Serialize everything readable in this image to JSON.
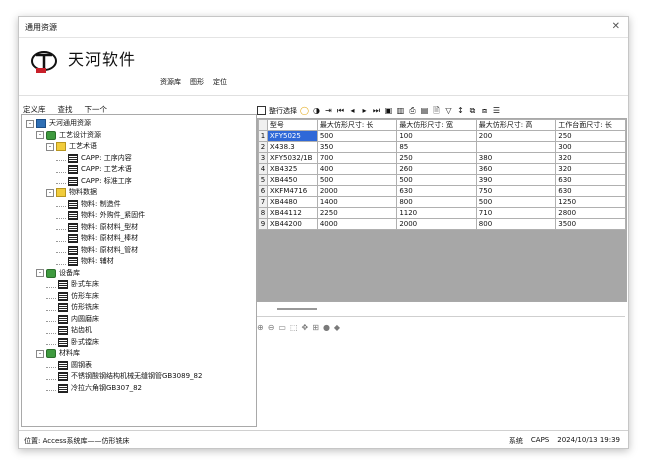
{
  "window": {
    "title": "通用资源"
  },
  "logo": {
    "text": "天河软件",
    "tag": "TIANHE"
  },
  "top_menu": [
    "资源库",
    "图形",
    "定位"
  ],
  "left_menu": [
    "定义库",
    "查找",
    "下一个"
  ],
  "tree": [
    {
      "label": "天河通用资源",
      "depth": 0,
      "icon": "root-icon",
      "expander": "-"
    },
    {
      "label": "工艺设计资源",
      "depth": 1,
      "icon": "gear-folder-icon",
      "expander": "-"
    },
    {
      "label": "工艺术语",
      "depth": 2,
      "icon": "folder-icon",
      "expander": "-"
    },
    {
      "label": "CAPP: 工序内容",
      "depth": 3,
      "icon": "table-icon",
      "expander": ""
    },
    {
      "label": "CAPP: 工艺术语",
      "depth": 3,
      "icon": "table-icon",
      "expander": ""
    },
    {
      "label": "CAPP: 标准工序",
      "depth": 3,
      "icon": "table-icon",
      "expander": ""
    },
    {
      "label": "物料数据",
      "depth": 2,
      "icon": "folder-icon",
      "expander": "-"
    },
    {
      "label": "物料: 制造件",
      "depth": 3,
      "icon": "table-icon",
      "expander": ""
    },
    {
      "label": "物料: 外购件_紧固件",
      "depth": 3,
      "icon": "table-icon",
      "expander": ""
    },
    {
      "label": "物料: 原材料_型材",
      "depth": 3,
      "icon": "table-icon",
      "expander": ""
    },
    {
      "label": "物料: 原材料_棒材",
      "depth": 3,
      "icon": "table-icon",
      "expander": ""
    },
    {
      "label": "物料: 原材料_管材",
      "depth": 3,
      "icon": "table-icon",
      "expander": ""
    },
    {
      "label": "物料: 辅材",
      "depth": 3,
      "icon": "table-icon",
      "expander": ""
    },
    {
      "label": "设备库",
      "depth": 1,
      "icon": "gear-folder-icon",
      "expander": "-"
    },
    {
      "label": "卧式车床",
      "depth": 2,
      "icon": "table-icon",
      "expander": ""
    },
    {
      "label": "仿形车床",
      "depth": 2,
      "icon": "table-icon",
      "expander": ""
    },
    {
      "label": "仿形铣床",
      "depth": 2,
      "icon": "table-icon",
      "expander": ""
    },
    {
      "label": "内圆磨床",
      "depth": 2,
      "icon": "table-icon",
      "expander": ""
    },
    {
      "label": "钻齿机",
      "depth": 2,
      "icon": "table-icon",
      "expander": ""
    },
    {
      "label": "卧式镗床",
      "depth": 2,
      "icon": "table-icon",
      "expander": ""
    },
    {
      "label": "材料库",
      "depth": 1,
      "icon": "gear-folder-icon",
      "expander": "-"
    },
    {
      "label": "圆钢表",
      "depth": 2,
      "icon": "table-icon",
      "expander": ""
    },
    {
      "label": "不锈钢酸钢结构机械无缝钢管GB3089_82",
      "depth": 2,
      "icon": "table-icon",
      "expander": ""
    },
    {
      "label": "冷拉六角钢GB307_82",
      "depth": 2,
      "icon": "table-icon",
      "expander": ""
    }
  ],
  "toolbar": {
    "select_label": "整行选择"
  },
  "grid": {
    "columns": [
      "型号",
      "最大仿形尺寸: 长",
      "最大仿形尺寸: 宽",
      "最大仿形尺寸: 高",
      "工作台面尺寸: 长"
    ],
    "rows": [
      {
        "num": "1",
        "cells": [
          "XFY5025",
          "500",
          "100",
          "200",
          "250"
        ]
      },
      {
        "num": "2",
        "cells": [
          "X438.3",
          "350",
          "85",
          "",
          "300"
        ]
      },
      {
        "num": "3",
        "cells": [
          "XFY5032/1B",
          "700",
          "250",
          "380",
          "320"
        ]
      },
      {
        "num": "4",
        "cells": [
          "XB4325",
          "400",
          "260",
          "360",
          "320"
        ]
      },
      {
        "num": "5",
        "cells": [
          "XB4450",
          "500",
          "500",
          "390",
          "630"
        ]
      },
      {
        "num": "6",
        "cells": [
          "XKFM4716",
          "2000",
          "630",
          "750",
          "630"
        ]
      },
      {
        "num": "7",
        "cells": [
          "XB4480",
          "1400",
          "800",
          "500",
          "1250"
        ]
      },
      {
        "num": "8",
        "cells": [
          "XB44112",
          "2250",
          "1120",
          "710",
          "2800"
        ]
      },
      {
        "num": "9",
        "cells": [
          "XB44200",
          "4000",
          "2000",
          "800",
          "3500"
        ]
      }
    ]
  },
  "status": {
    "location": "位置: Access系统库——仿形铣床",
    "user": "系统",
    "app": "CAPS",
    "datetime": "2024/10/13  19:39"
  },
  "colors": {
    "selection": "#2f68d8",
    "grid_empty": "#a7a7a7",
    "logo_red": "#c8202a"
  }
}
